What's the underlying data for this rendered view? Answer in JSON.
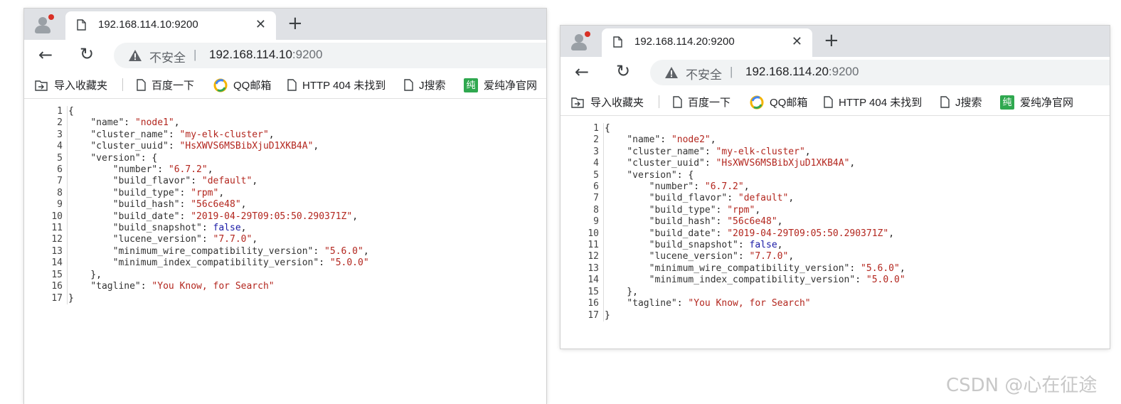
{
  "browser_ui": {
    "insecure_label": "不安全",
    "separator": "|",
    "close_glyph": "✕",
    "new_tab_glyph": "+",
    "back_glyph": "←",
    "reload_glyph": "↻",
    "bookmarks": [
      {
        "label": "导入收藏夹",
        "icon": "import-bookmarks-icon"
      },
      {
        "label": "百度一下",
        "icon": "page-icon"
      },
      {
        "label": "QQ邮箱",
        "icon": "qq-mail-icon"
      },
      {
        "label": "HTTP 404 未找到",
        "icon": "page-icon"
      },
      {
        "label": "J搜索",
        "icon": "page-icon"
      },
      {
        "label": "爱纯净官网",
        "icon": "chun-icon",
        "icon_text": "纯"
      }
    ]
  },
  "windows": [
    {
      "tab_title": "192.168.114.10:9200",
      "url_host": "192.168.114.10",
      "url_port": ":9200",
      "json": {
        "name": "node1",
        "cluster_name": "my-elk-cluster",
        "cluster_uuid": "HsXWVS6MSBibXjuD1XKB4A",
        "version": {
          "number": "6.7.2",
          "build_flavor": "default",
          "build_type": "rpm",
          "build_hash": "56c6e48",
          "build_date": "2019-04-29T09:05:50.290371Z",
          "build_snapshot": "false",
          "lucene_version": "7.7.0",
          "minimum_wire_compatibility_version": "5.6.0",
          "minimum_index_compatibility_version": "5.0.0"
        },
        "tagline": "You Know, for Search"
      }
    },
    {
      "tab_title": "192.168.114.20:9200",
      "url_host": "192.168.114.20",
      "url_port": ":9200",
      "json": {
        "name": "node2",
        "cluster_name": "my-elk-cluster",
        "cluster_uuid": "HsXWVS6MSBibXjuD1XKB4A",
        "version": {
          "number": "6.7.2",
          "build_flavor": "default",
          "build_type": "rpm",
          "build_hash": "56c6e48",
          "build_date": "2019-04-29T09:05:50.290371Z",
          "build_snapshot": "false",
          "lucene_version": "7.7.0",
          "minimum_wire_compatibility_version": "5.6.0",
          "minimum_index_compatibility_version": "5.0.0"
        },
        "tagline": "You Know, for Search"
      }
    }
  ],
  "line_numbers": [
    "1",
    "2",
    "3",
    "4",
    "5",
    "6",
    "7",
    "8",
    "9",
    "10",
    "11",
    "12",
    "13",
    "14",
    "15",
    "16",
    "17"
  ],
  "watermark": "CSDN @心在征途"
}
